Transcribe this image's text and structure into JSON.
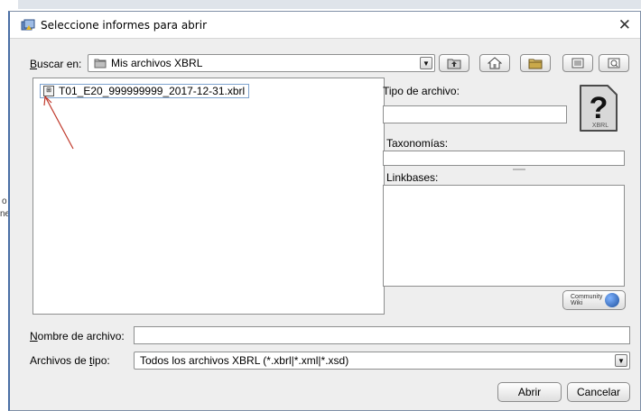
{
  "background": {
    "fragment_1": "o",
    "fragment_2": "ne"
  },
  "dialog": {
    "title": "Seleccione informes para abrir",
    "close_glyph": "✕"
  },
  "lookin": {
    "label_mnemonic": "B",
    "label_rest": "uscar en:",
    "value": "Mis archivos XBRL"
  },
  "toolbar": {
    "buttons": [
      "up-folder",
      "home",
      "new-folder",
      "list-view",
      "details-view"
    ]
  },
  "files": [
    {
      "name": "T01_E20_999999999_2017-12-31.xbrl"
    }
  ],
  "info_panel": {
    "file_type_label": "Tipo de archivo:",
    "file_type_value": "",
    "taxonomies_label": "Taxonomías:",
    "taxonomies_value": "",
    "linkbases_label": "Linkbases:",
    "icon_glyph": "?",
    "icon_caption": "XBRL",
    "wiki_button_label_1": "Community",
    "wiki_button_label_2": "Wiki"
  },
  "filename": {
    "label_mnemonic": "N",
    "label_rest": "ombre de archivo:",
    "value": ""
  },
  "filetype": {
    "label_pre": "Archivos de ",
    "label_mnemonic": "t",
    "label_post": "ipo:",
    "value": "Todos los archivos XBRL (*.xbrl|*.xml|*.xsd)"
  },
  "buttons": {
    "open": "Abrir",
    "cancel": "Cancelar"
  },
  "colors": {
    "accent_border": "#4a6fa5",
    "annotation_arrow": "#c0392b"
  }
}
